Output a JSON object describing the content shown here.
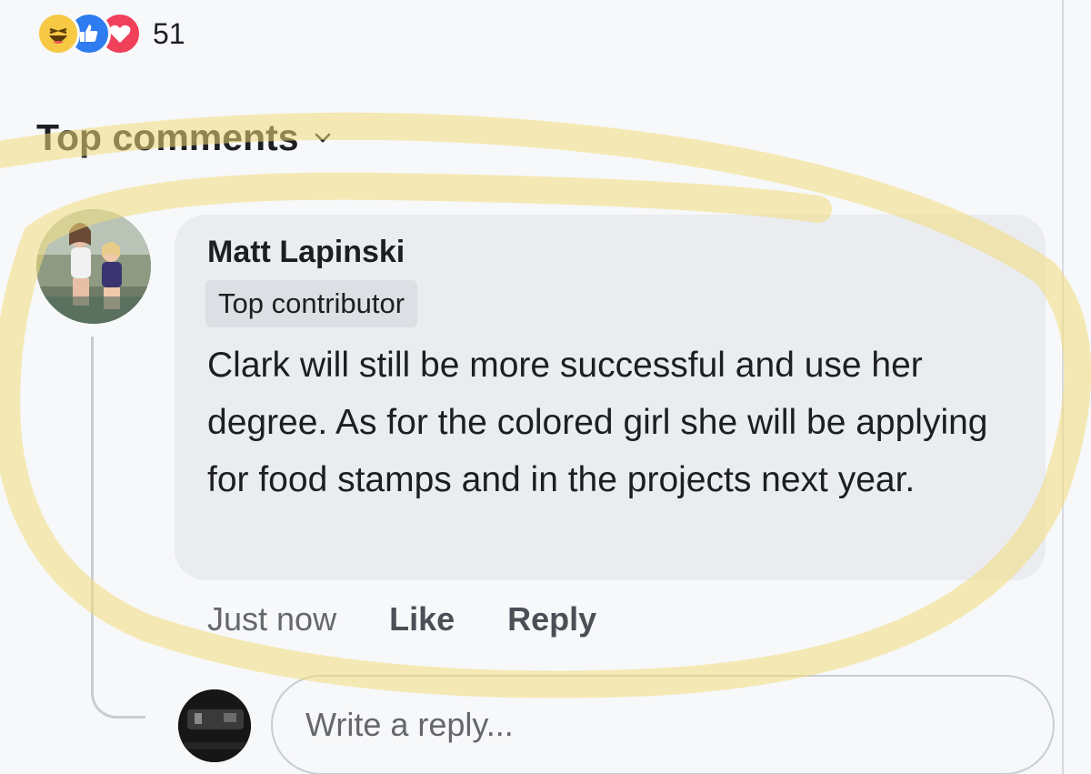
{
  "reactions": {
    "count": "51",
    "icons": [
      "haha-icon",
      "like-icon",
      "love-icon"
    ],
    "colors": {
      "haha": "#f7c843",
      "like": "#2f7cf0",
      "love": "#f0405a"
    }
  },
  "comments_header": {
    "label": "Top comments"
  },
  "comment": {
    "author": "Matt Lapinski",
    "badge": "Top contributor",
    "text": "Clark will still be more successful and use her degree. As for the colored girl she will be applying for food stamps and in the projects next year.",
    "timestamp": "Just now",
    "like_label": "Like",
    "reply_label": "Reply"
  },
  "reply": {
    "placeholder": "Write a reply..."
  },
  "highlight_color": "#f5e28a"
}
